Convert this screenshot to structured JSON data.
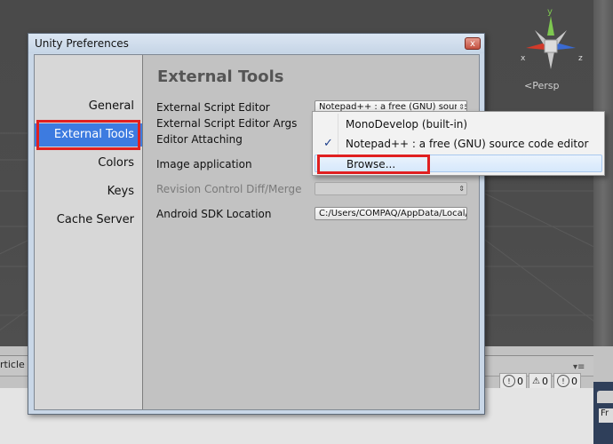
{
  "window": {
    "title": "Unity Preferences",
    "close_glyph": "x"
  },
  "sidebar": {
    "items": [
      {
        "label": "General"
      },
      {
        "label": "External Tools",
        "selected": true
      },
      {
        "label": "Colors"
      },
      {
        "label": "Keys"
      },
      {
        "label": "Cache Server"
      }
    ]
  },
  "content": {
    "section_title": "External Tools",
    "rows": [
      {
        "label": "External Script Editor",
        "value": "Notepad++ : a free (GNU) source code editor"
      },
      {
        "label": "External Script Editor Args"
      },
      {
        "label": "Editor Attaching"
      },
      {
        "label": "Image application"
      },
      {
        "label": "Revision Control Diff/Merge",
        "value": "",
        "disabled": true
      },
      {
        "label": "Android SDK Location",
        "value": "C:/Users/COMPAQ/AppData/Local/Android/sdk"
      }
    ]
  },
  "dropdown": {
    "items": [
      {
        "label": "MonoDevelop (built-in)",
        "checked": false
      },
      {
        "label": "Notepad++ : a free (GNU) source code editor",
        "checked": true
      },
      {
        "label": "Browse...",
        "checked": false,
        "highlighted": true
      }
    ],
    "check_glyph": "✓"
  },
  "scene": {
    "view_label": "<Persp",
    "axis_labels": {
      "y": "y",
      "x": "x",
      "z": "z"
    }
  },
  "console": {
    "tab_label": "rticle",
    "info_count": "0",
    "warning_count": "0",
    "error_count": "0"
  },
  "inspector": {
    "tab_text": "Fr"
  },
  "colors": {
    "selection_blue": "#3d7be0",
    "highlight_red": "#e02020",
    "axis_y": "#7ec850",
    "axis_x": "#d23a2a",
    "axis_z": "#3a6ad2"
  }
}
